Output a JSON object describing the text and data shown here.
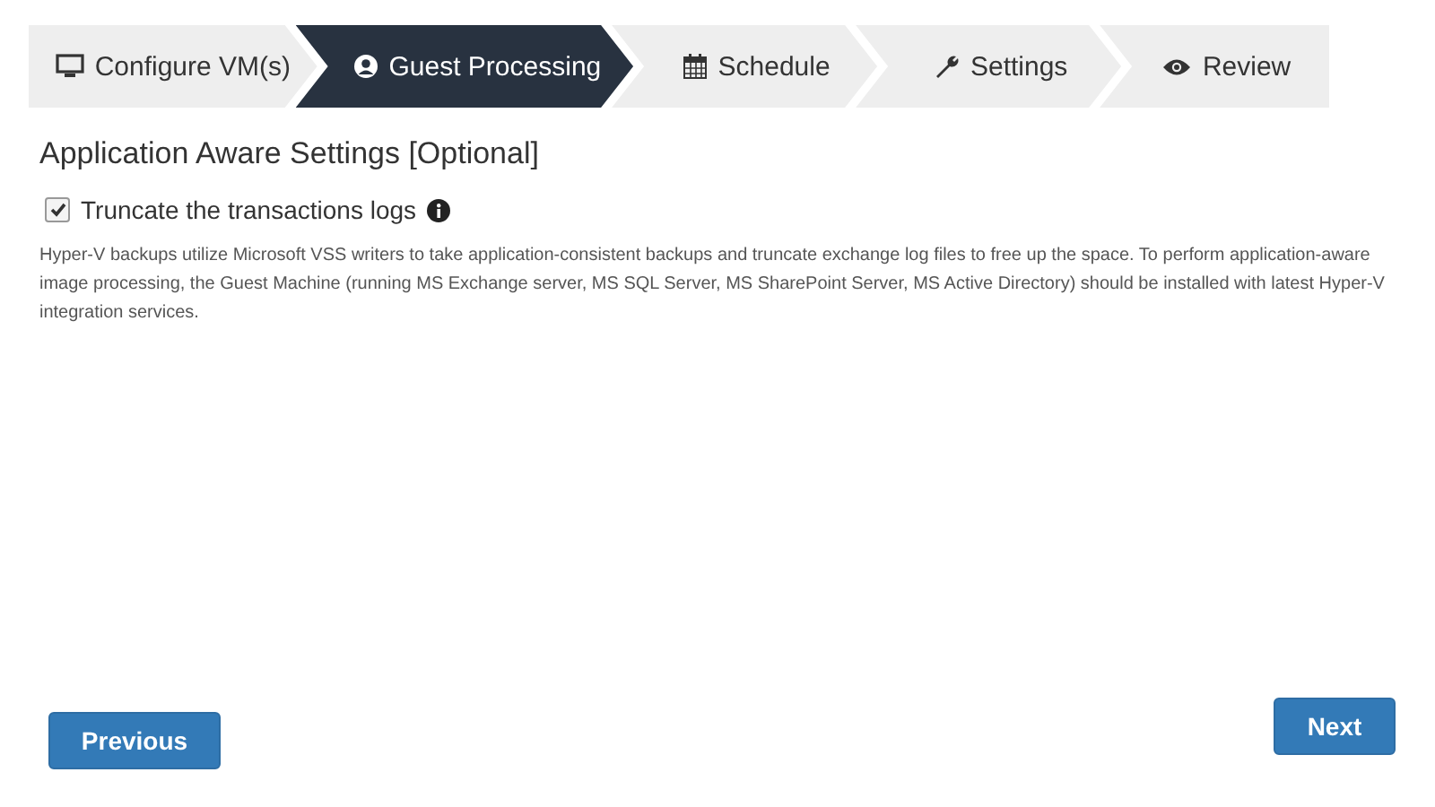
{
  "steps": [
    {
      "label": "Configure VM(s)",
      "kind": "monitor",
      "selected": false
    },
    {
      "label": "Guest Processing",
      "kind": "user",
      "selected": true
    },
    {
      "label": "Schedule",
      "kind": "calendar",
      "selected": false
    },
    {
      "label": "Settings",
      "kind": "wrench",
      "selected": false
    },
    {
      "label": "Review",
      "kind": "eye",
      "selected": false
    }
  ],
  "section": {
    "title": "Application Aware Settings [Optional]",
    "option": {
      "label": "Truncate the transactions logs",
      "checked": true
    },
    "description": "Hyper-V backups utilize Microsoft VSS writers to take application-consistent backups and truncate exchange log files to free up the space. To perform application-aware image processing, the Guest Machine (running MS Exchange server, MS SQL Server, MS SharePoint Server, MS Active Directory) should be installed with latest Hyper-V integration services."
  },
  "buttons": {
    "previous": "Previous",
    "next": "Next"
  }
}
